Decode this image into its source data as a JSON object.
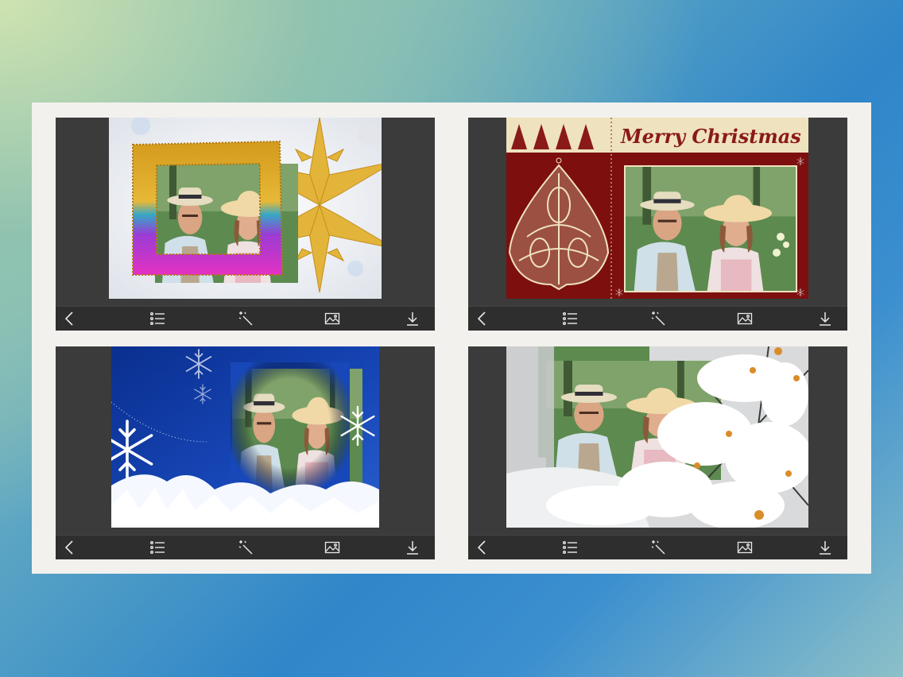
{
  "frames": [
    {
      "id": "tinsel-frame",
      "caption": ""
    },
    {
      "id": "merry-christmas-card",
      "caption": "Merry Christmas"
    },
    {
      "id": "blue-snowflake-frame",
      "caption": ""
    },
    {
      "id": "snowy-branches-frame",
      "caption": ""
    }
  ],
  "toolbar": {
    "icons": [
      "back-icon",
      "list-icon",
      "magic-wand-icon",
      "image-icon",
      "download-icon"
    ]
  },
  "colors": {
    "panel": "#3b3b3b",
    "toolbar": "#2e2e2e",
    "sheet": "#f2f1ee",
    "card_red": "#7d0f0f",
    "card_cream": "#efe2bf"
  }
}
